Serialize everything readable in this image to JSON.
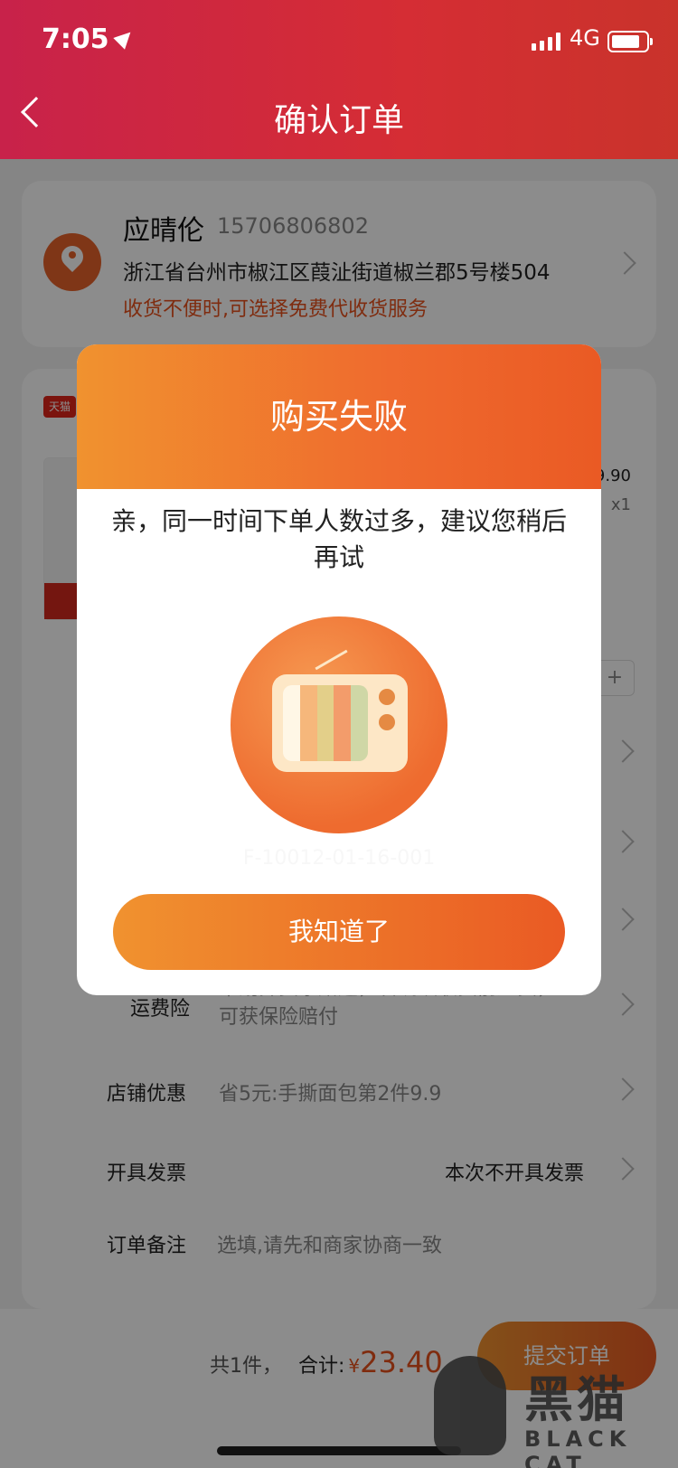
{
  "status_bar": {
    "time": "7:05",
    "network": "4G"
  },
  "nav": {
    "title": "确认订单"
  },
  "address": {
    "name": "应晴伦",
    "phone": "15706806802",
    "detail": "浙江省台州市椒江区葭沚街道椒兰郡5号楼504",
    "hint": "收货不便时,可选择免费代收货服务"
  },
  "shop": {
    "tag": "天猫"
  },
  "product": {
    "price_partial": "9.90",
    "quantity": "x1",
    "stepper_plus": "+"
  },
  "rows": {
    "insurance_label": "运费险",
    "insurance_value": "聚划算卖家赠送，若确认收货前退货，可获保险赔付",
    "shop_discount_label": "店铺优惠",
    "shop_discount_value": "省5元:手撕面包第2件9.9",
    "invoice_label": "开具发票",
    "invoice_value": "本次不开具发票",
    "note_label": "订单备注",
    "note_placeholder": "选填,请先和商家协商一致"
  },
  "footer": {
    "count": "共1件，",
    "total_label": "合计:",
    "currency": "¥",
    "amount": "23.40",
    "submit": "提交订单"
  },
  "modal": {
    "title": "购买失败",
    "message": "亲，同一时间下单人数过多，建议您稍后再试",
    "error_code": "F-10012-01-16-001",
    "button": "我知道了"
  },
  "watermark": {
    "cn": "黑猫",
    "en": "BLACK CAT"
  },
  "colors": {
    "accent": "#ea5a24",
    "header": "#c8224a"
  }
}
